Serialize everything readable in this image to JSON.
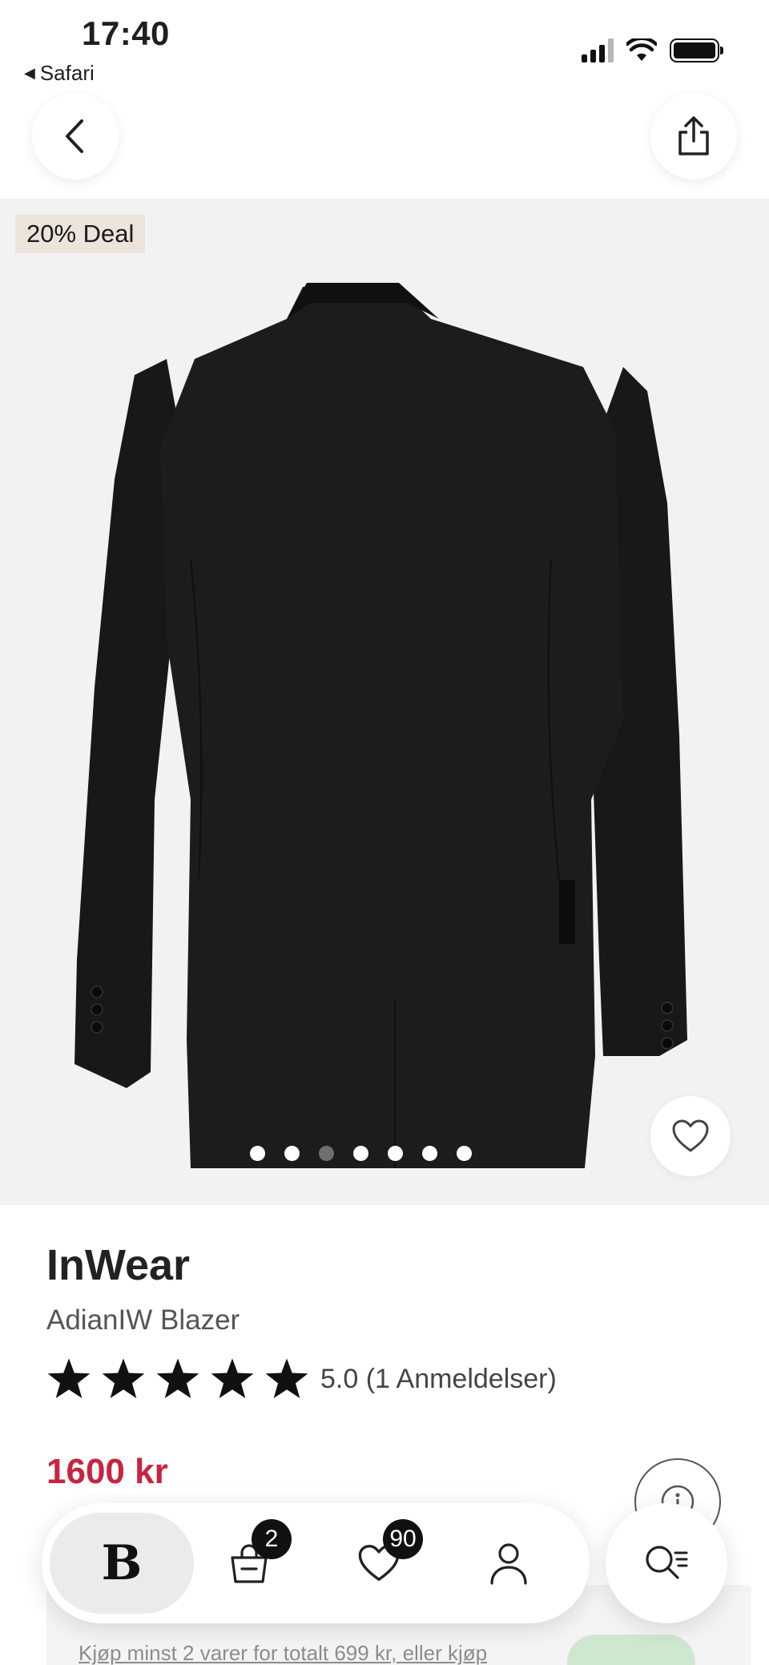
{
  "status_bar": {
    "time": "17:40",
    "back_app": "Safari"
  },
  "gallery": {
    "deal_badge": "20% Deal",
    "dot_count": 7,
    "active_dot_index": 2
  },
  "product": {
    "brand": "InWear",
    "name": "AdianIW Blazer",
    "rating_value": 5,
    "rating_text": "5.0 (1 Anmeldelser)",
    "price": "1600 kr"
  },
  "promo": {
    "text": "Kjøp minst 2 varer for totalt 699 kr, eller kjøp"
  },
  "bottom_nav": {
    "home_label": "B",
    "bag_count": "2",
    "wishlist_count": "90"
  },
  "colors": {
    "price": "#c8243f",
    "badge_bg": "#ece4da",
    "gallery_bg": "#f2f2f2"
  }
}
